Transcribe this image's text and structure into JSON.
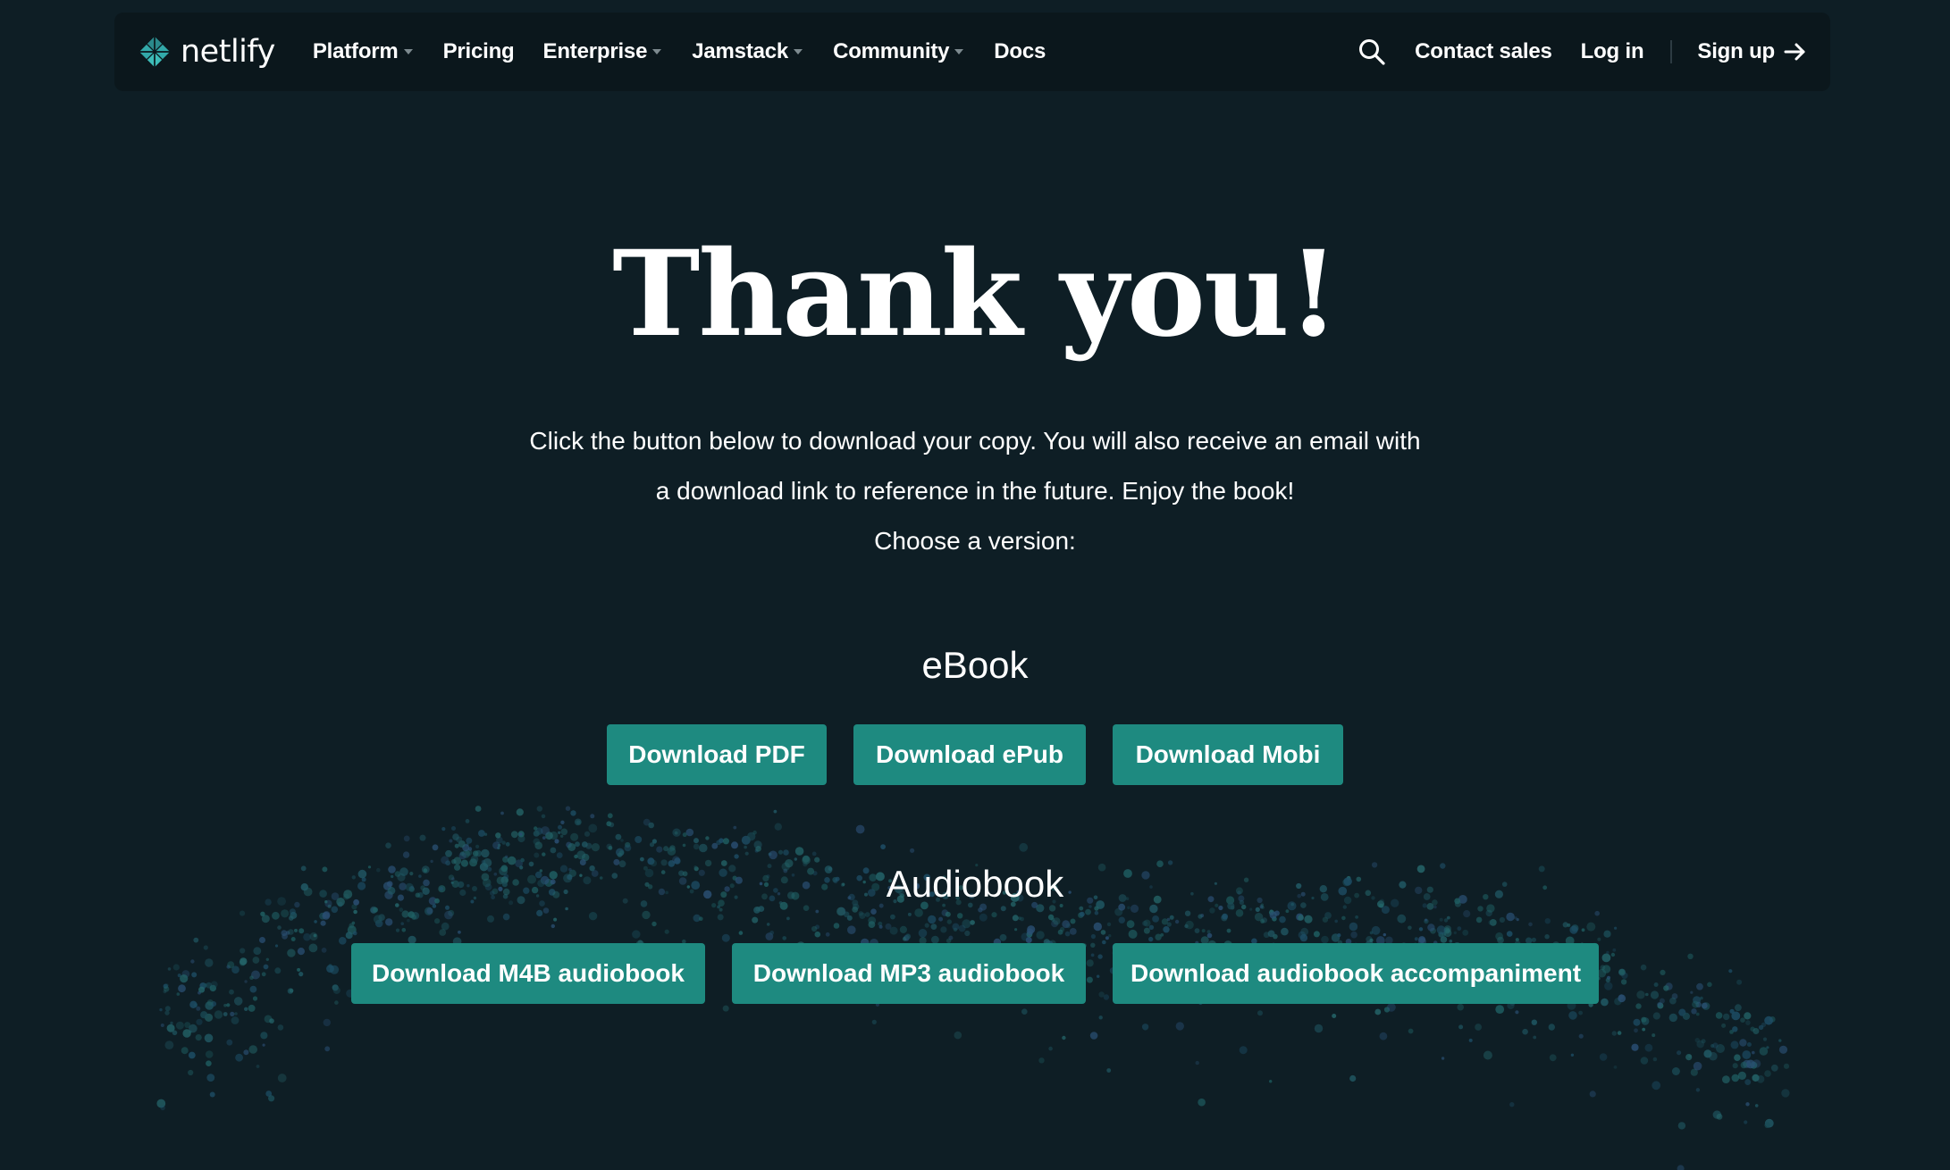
{
  "brand": {
    "name": "netlify",
    "logo_icon": "netlify-diamond-logo",
    "accent_color": "#32a9a9"
  },
  "nav": {
    "items": [
      {
        "label": "Platform",
        "has_dropdown": true
      },
      {
        "label": "Pricing",
        "has_dropdown": false
      },
      {
        "label": "Enterprise",
        "has_dropdown": true
      },
      {
        "label": "Jamstack",
        "has_dropdown": true
      },
      {
        "label": "Community",
        "has_dropdown": true
      },
      {
        "label": "Docs",
        "has_dropdown": false
      }
    ],
    "search_icon": "search-icon",
    "contact_sales": "Contact sales",
    "log_in": "Log in",
    "sign_up": "Sign up",
    "sign_up_icon": "arrow-right-icon"
  },
  "hero": {
    "title": "Thank you!",
    "intro": "Click the button below to download your copy. You will also receive an email with a download link to reference in the future. Enjoy the book!",
    "choose": "Choose a version:"
  },
  "ebook": {
    "title": "eBook",
    "buttons": [
      "Download PDF",
      "Download ePub",
      "Download Mobi"
    ]
  },
  "audiobook": {
    "title": "Audiobook",
    "buttons": [
      "Download M4B audiobook",
      "Download MP3 audiobook",
      "Download audiobook accompaniment"
    ]
  },
  "colors": {
    "background": "#0e1e25",
    "nav_background": "#0b171c",
    "button": "#1e8a80",
    "text": "#ffffff"
  }
}
